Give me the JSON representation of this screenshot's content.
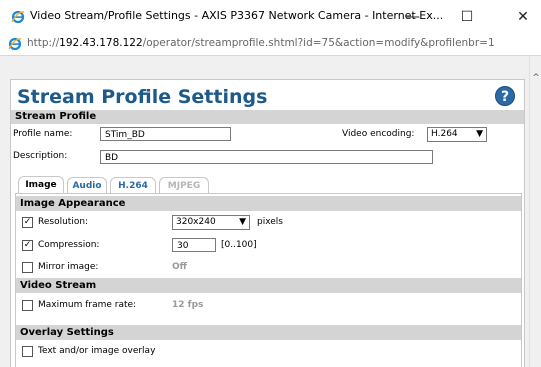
{
  "window": {
    "title": "Video Stream/Profile Settings - AXIS P3367 Network Camera - Internet Ex...",
    "minimize_glyph": "—",
    "maximize_glyph": "☐",
    "close_glyph": "✕"
  },
  "address": {
    "scheme": "http://",
    "host": "192.43.178.122",
    "path": "/operator/streamprofile.shtml?id=75&action=modify&profilenbr=1"
  },
  "page": {
    "title": "Stream Profile Settings",
    "help_glyph": "?",
    "section_stream_profile": "Stream Profile",
    "profile_name_label": "Profile name:",
    "profile_name_value": "STim_BD",
    "video_encoding_label": "Video encoding:",
    "video_encoding_value": "H.264",
    "description_label": "Description:",
    "description_value": "BD"
  },
  "tabs": [
    {
      "label": "Image",
      "state": "active"
    },
    {
      "label": "Audio",
      "state": "inactive"
    },
    {
      "label": "H.264",
      "state": "inactive"
    },
    {
      "label": "MJPEG",
      "state": "disabled"
    }
  ],
  "image_appearance": {
    "header": "Image Appearance",
    "resolution_label": "Resolution:",
    "resolution_checked": true,
    "resolution_value": "320x240",
    "resolution_unit": "pixels",
    "compression_label": "Compression:",
    "compression_checked": true,
    "compression_value": "30",
    "compression_range": "[0..100]",
    "mirror_label": "Mirror image:",
    "mirror_checked": false,
    "mirror_value": "Off"
  },
  "video_stream": {
    "header": "Video Stream",
    "max_frame_rate_label": "Maximum frame rate:",
    "max_frame_rate_checked": false,
    "max_frame_rate_value": "12 fps"
  },
  "overlay": {
    "header": "Overlay Settings",
    "text_overlay_label": "Text and/or image overlay",
    "text_overlay_checked": false
  },
  "scrollbar": {
    "up_glyph": "^"
  },
  "colors": {
    "accent": "#1d5a8a",
    "tab_link": "#2c6aa6",
    "section_bg": "#d4d4d4"
  }
}
